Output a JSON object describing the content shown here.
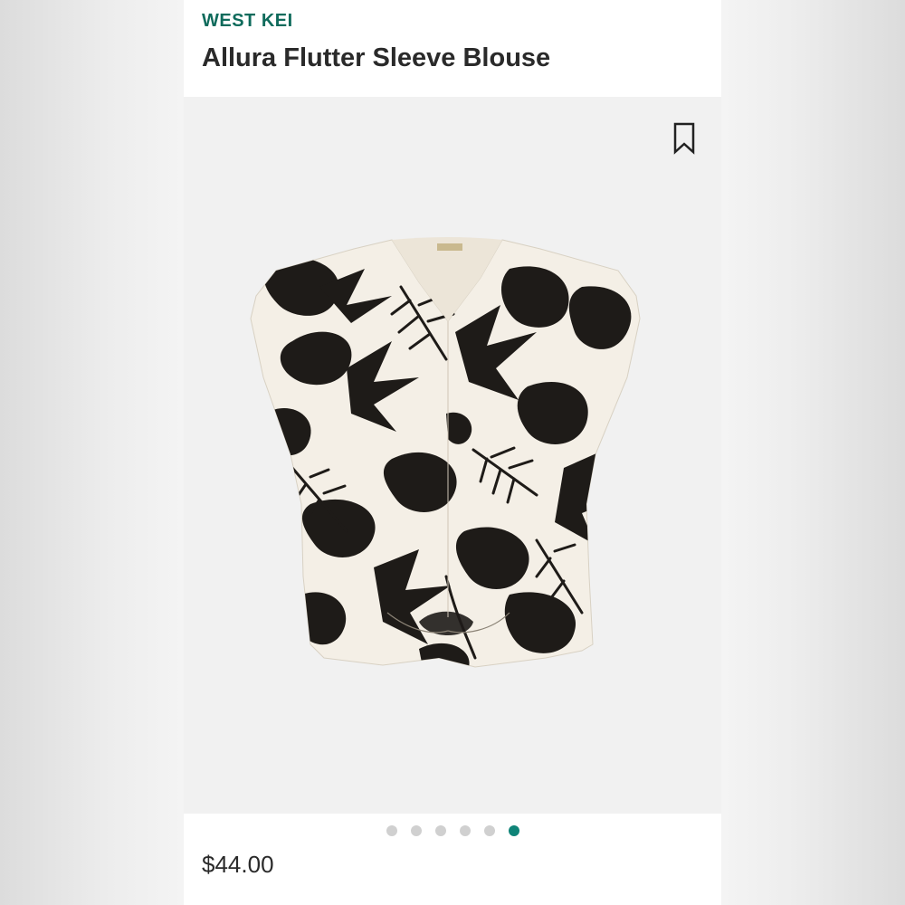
{
  "product": {
    "brand": "WEST KEI",
    "title": "Allura Flutter Sleeve Blouse",
    "price": "$44.00"
  },
  "gallery": {
    "image_count": 6,
    "active_index": 5
  },
  "icons": {
    "bookmark": "bookmark-icon"
  },
  "colors": {
    "brand_accent": "#0f6b5c",
    "active_dot": "#0f8478",
    "inactive_dot": "#d0d0d0",
    "print_dark": "#1e1b18",
    "fabric_cream": "#f4efe6"
  }
}
